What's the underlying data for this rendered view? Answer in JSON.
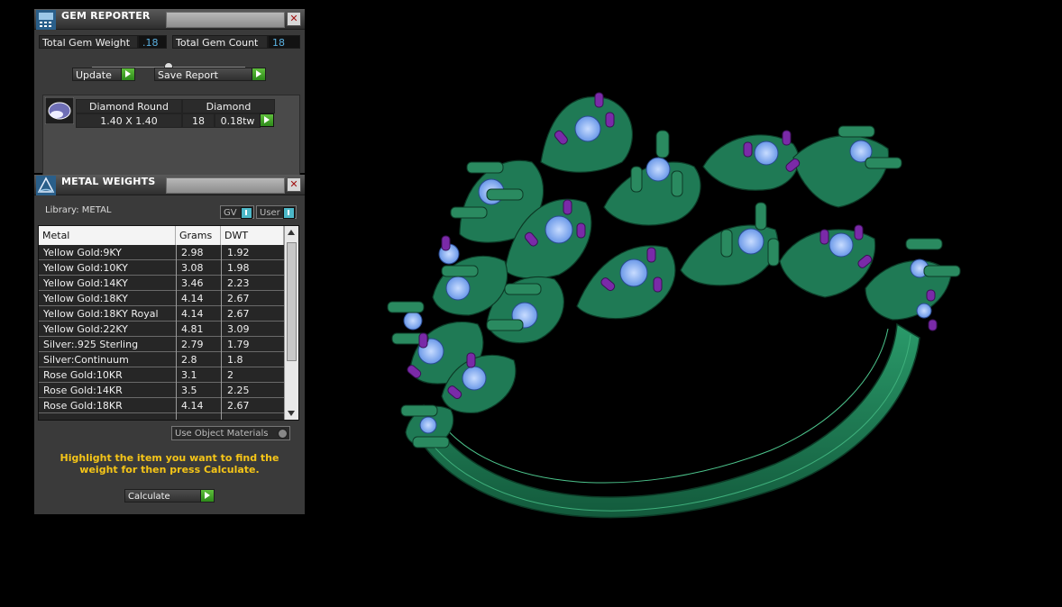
{
  "gem_reporter": {
    "title": "GEM REPORTER",
    "total_weight_label": "Total Gem Weight",
    "total_weight_value": ".18",
    "total_count_label": "Total Gem Count",
    "total_count_value": "18",
    "update_label": "Update",
    "save_report_label": "Save Report",
    "table": {
      "shape": "Diamond Round",
      "material": "Diamond",
      "size": "1.40 X 1.40",
      "count": "18",
      "weight": "0.18tw"
    }
  },
  "metal_weights": {
    "title": "METAL WEIGHTS",
    "library_label": "Library: METAL",
    "gv_label": "GV",
    "user_label": "User",
    "columns": [
      "Metal",
      "Grams",
      "DWT"
    ],
    "rows": [
      {
        "metal": "Yellow Gold:9KY",
        "grams": "2.98",
        "dwt": "1.92"
      },
      {
        "metal": "Yellow Gold:10KY",
        "grams": "3.08",
        "dwt": "1.98"
      },
      {
        "metal": "Yellow Gold:14KY",
        "grams": "3.46",
        "dwt": "2.23"
      },
      {
        "metal": "Yellow Gold:18KY",
        "grams": "4.14",
        "dwt": "2.67"
      },
      {
        "metal": "Yellow Gold:18KY Royal",
        "grams": "4.14",
        "dwt": "2.67"
      },
      {
        "metal": "Yellow Gold:22KY",
        "grams": "4.81",
        "dwt": "3.09"
      },
      {
        "metal": "Silver:.925 Sterling",
        "grams": "2.79",
        "dwt": "1.79"
      },
      {
        "metal": "Silver:Continuum",
        "grams": "2.8",
        "dwt": "1.8"
      },
      {
        "metal": "Rose Gold:10KR",
        "grams": "3.1",
        "dwt": "2"
      },
      {
        "metal": "Rose Gold:14KR",
        "grams": "3.5",
        "dwt": "2.25"
      },
      {
        "metal": "Rose Gold:18KR",
        "grams": "4.14",
        "dwt": "2.67"
      }
    ],
    "use_object_materials_label": "Use Object Materials",
    "hint": "Highlight the item you want to find the weight for then press Calculate.",
    "calculate_label": "Calculate"
  },
  "colors": {
    "model_green": "#1f7a55",
    "stone_blue": "#8ab8f0",
    "prong_purple": "#7a2aa8",
    "hint_yellow": "#f5c518"
  }
}
